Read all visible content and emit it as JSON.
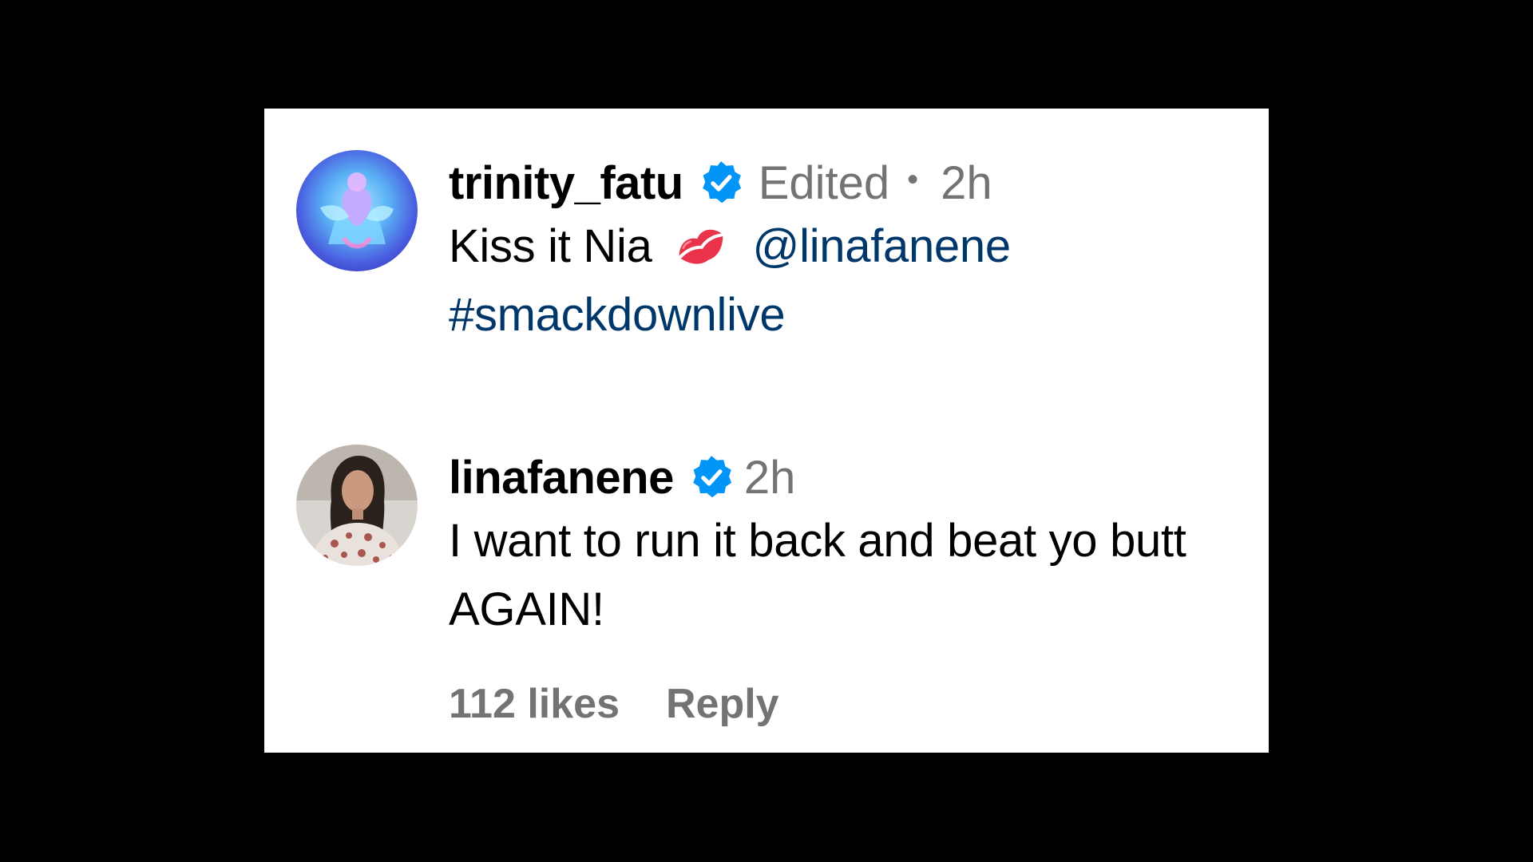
{
  "comments": [
    {
      "username": "trinity_fatu",
      "verified": true,
      "edited_label": "Edited",
      "separator": "•",
      "time": "2h",
      "text_part1": "Kiss it Nia",
      "emoji": "kiss-mark-icon",
      "mention": "@linafanene",
      "hashtag": "#smackdownlive",
      "avatar": "avatar-trinity-icon"
    },
    {
      "username": "linafanene",
      "verified": true,
      "time": "2h",
      "text": "I want to run it back and beat yo butt AGAIN!",
      "avatar": "avatar-lina-icon",
      "likes": "112 likes",
      "reply_label": "Reply"
    }
  ],
  "colors": {
    "background": "#000000",
    "panel": "#ffffff",
    "verified_badge": "#0095f6",
    "link": "#00376b",
    "muted": "#737373",
    "kiss_red": "#e8334a"
  }
}
